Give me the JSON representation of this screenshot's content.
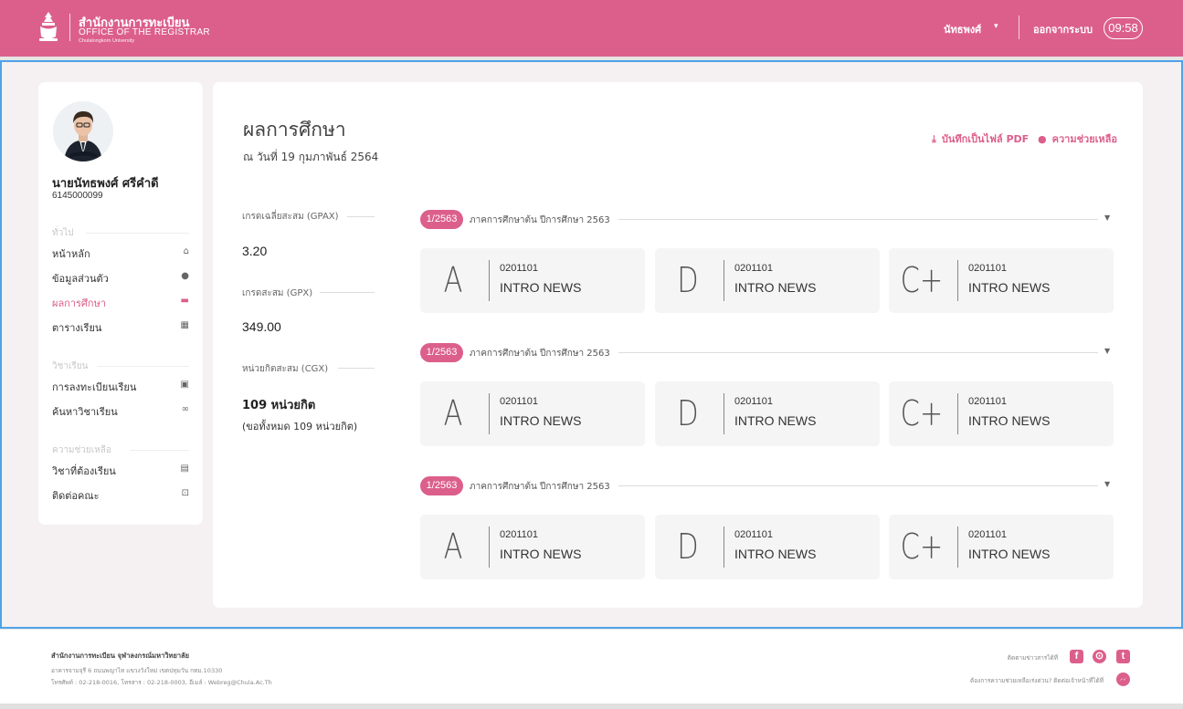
{
  "header": {
    "org_th": "สำนักงานการทะเบียน",
    "org_en": "OFFICE OF THE REGISTRAR",
    "org_sub": "Chulalongkorn University",
    "user_label": "นัทธพงศ์",
    "logout_label": "ออกจากระบบ",
    "session_time": "09:58",
    "user_caret": "▾"
  },
  "sidebar": {
    "name": "นายนัทธพงศ์ ศรีคำดี",
    "student_id": "6145000099",
    "sections": [
      {
        "title": "ทั่วไป",
        "items": [
          {
            "label": "หน้าหลัก",
            "icon": "home-icon",
            "glyph": "⌂"
          },
          {
            "label": "ข้อมูลส่วนตัว",
            "icon": "user-icon",
            "glyph": "●"
          },
          {
            "label": "ผลการศึกษา",
            "icon": "scroll-icon",
            "glyph": "▬",
            "active": true
          },
          {
            "label": "ตารางเรียน",
            "icon": "calendar-icon",
            "glyph": "▦"
          }
        ]
      },
      {
        "title": "วิชาเรียน",
        "items": [
          {
            "label": "การลงทะเบียนเรียน",
            "icon": "calendar-check-icon",
            "glyph": "▣"
          },
          {
            "label": "ค้นหาวิชาเรียน",
            "icon": "binoculars-icon",
            "glyph": "∞"
          }
        ]
      },
      {
        "title": "ความช่วยเหลือ",
        "items": [
          {
            "label": "วิชาที่ต้องเรียน",
            "icon": "book-icon",
            "glyph": "▤"
          },
          {
            "label": "ติดต่อคณะ",
            "icon": "inbox-icon",
            "glyph": "⊡"
          }
        ]
      }
    ]
  },
  "main": {
    "title": "ผลการศึกษา",
    "as_of": "ณ วันที่ 19 กุมภาพันธ์ 2564",
    "action_pdf": "บันทึกเป็นไฟล์ PDF",
    "action_help": "ความช่วยเหลือ",
    "stats": {
      "gpax_label": "เกรดเฉลี่ยสะสม (GPAX)",
      "gpax_value": "3.20",
      "gpx_label": "เกรดสะสม (GPX)",
      "gpx_value": "349.00",
      "cgx_label": "หน่วยกิตสะสม (CGX)",
      "cgx_value": "109 หน่วยกิต",
      "cgx_note": "(ขอทั้งหมด 109 หน่วยกิต)"
    },
    "terms": [
      {
        "badge": "1/2563",
        "label": "ภาคการศึกษาต้น ปีการศึกษา 2563",
        "courses": [
          {
            "grade": "A",
            "code": "0201101",
            "name": "INTRO NEWS"
          },
          {
            "grade": "D",
            "code": "0201101",
            "name": "INTRO NEWS"
          },
          {
            "grade": "C+",
            "code": "0201101",
            "name": "INTRO NEWS"
          }
        ]
      },
      {
        "badge": "1/2563",
        "label": "ภาคการศึกษาต้น ปีการศึกษา 2563",
        "courses": [
          {
            "grade": "A",
            "code": "0201101",
            "name": "INTRO NEWS"
          },
          {
            "grade": "D",
            "code": "0201101",
            "name": "INTRO NEWS"
          },
          {
            "grade": "C+",
            "code": "0201101",
            "name": "INTRO NEWS"
          }
        ]
      },
      {
        "badge": "1/2563",
        "label": "ภาคการศึกษาต้น ปีการศึกษา 2563",
        "courses": [
          {
            "grade": "A",
            "code": "0201101",
            "name": "INTRO NEWS"
          },
          {
            "grade": "D",
            "code": "0201101",
            "name": "INTRO NEWS"
          },
          {
            "grade": "C+",
            "code": "0201101",
            "name": "INTRO NEWS"
          }
        ]
      }
    ]
  },
  "footer": {
    "org": "สำนักงานการทะเบียน จุฬาลงกรณ์มหาวิทยาลัย",
    "address": "อาคารจามจุรี 6 ถนนพญาไท แขวงวังใหม่ เขตปทุมวัน กทม.10330",
    "contact": "โทรศัพท์ : 02-218-0016, โทรสาร : 02-218-0003, อีเมล์ : Webreg@Chula.Ac.Th",
    "follow_text": "ติดตามข่าวสารได้ที่",
    "help_text": "ต้องการความช่วยเหลือเร่งด่วน? ติดต่อเจ้าหน้าที่ได้ที่",
    "social": [
      {
        "icon": "facebook-icon",
        "glyph": "f"
      },
      {
        "icon": "line-icon",
        "glyph": "⊙"
      },
      {
        "icon": "twitter-icon",
        "glyph": "t"
      }
    ]
  },
  "colors": {
    "brand": "#dc5f8b",
    "frame": "#4da3e8"
  }
}
